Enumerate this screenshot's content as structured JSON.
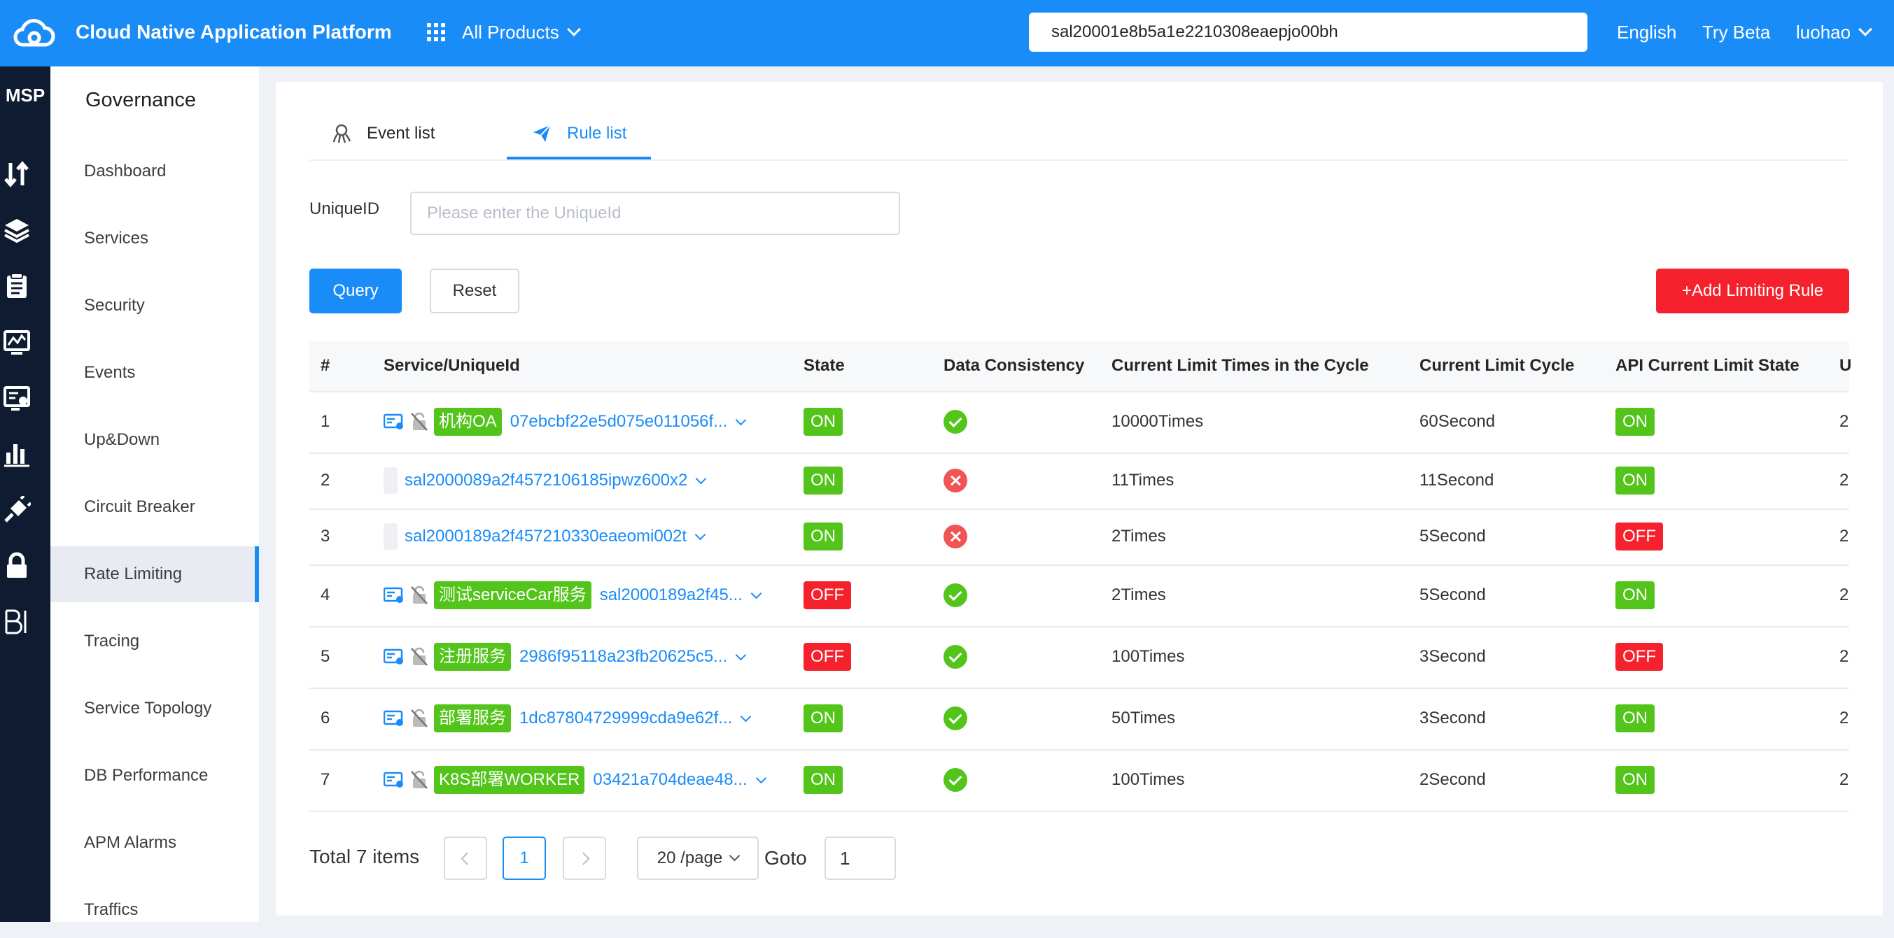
{
  "header": {
    "app_title": "Cloud Native Application Platform",
    "products_label": "All Products",
    "tenant_id": "sal20001e8b5a1e2210308eaepjo00bh",
    "language": "English",
    "try_beta": "Try Beta",
    "username": "luohao",
    "brand_color": "#1a8cf8"
  },
  "rail": {
    "label": "MSP",
    "icons": [
      "up-down-icon",
      "layers-icon",
      "clipboard-icon",
      "monitor-chart-icon",
      "monitor-user-icon",
      "bar-chart-icon",
      "plug-icon",
      "lock-icon",
      "bi-icon"
    ]
  },
  "menu": {
    "title": "Governance",
    "items": [
      "Dashboard",
      "Services",
      "Security",
      "Events",
      "Up&Down",
      "Circuit Breaker",
      "Rate Limiting",
      "Tracing",
      "Service Topology",
      "DB Performance",
      "APM Alarms",
      "Traffics"
    ],
    "active": "Rate Limiting"
  },
  "tabs": [
    {
      "label": "Event list",
      "icon": "octopus-icon",
      "active": false
    },
    {
      "label": "Rule list",
      "icon": "paper-plane-icon",
      "active": true
    }
  ],
  "filter": {
    "label": "UniqueID",
    "placeholder": "Please enter the UniqueId"
  },
  "buttons": {
    "query": "Query",
    "reset": "Reset",
    "add": "+Add Limiting Rule"
  },
  "table": {
    "columns": [
      "#",
      "Service/UniqueId",
      "State",
      "Data Consistency",
      "Current Limit Times in the Cycle",
      "Current Limit Cycle",
      "API Current Limit State",
      "U"
    ],
    "rows": [
      {
        "index": "1",
        "icons": true,
        "tag": "机构OA",
        "uid": "07ebcbf22e5d075e011056f...",
        "state": "ON",
        "consistent": true,
        "times": "10000Times",
        "cycle": "60Second",
        "api_state": "ON",
        "extra": "2"
      },
      {
        "index": "2",
        "icons": false,
        "tag": "",
        "uid": "sal2000089a2f4572106185ipwz600x2",
        "state": "ON",
        "consistent": false,
        "times": "11Times",
        "cycle": "11Second",
        "api_state": "ON",
        "extra": "2"
      },
      {
        "index": "3",
        "icons": false,
        "tag": "",
        "uid": "sal2000189a2f457210330eaeomi002t",
        "state": "ON",
        "consistent": false,
        "times": "2Times",
        "cycle": "5Second",
        "api_state": "OFF",
        "extra": "2"
      },
      {
        "index": "4",
        "icons": true,
        "tag": "测试serviceCar服务",
        "uid": "sal2000189a2f45...",
        "state": "OFF",
        "consistent": true,
        "times": "2Times",
        "cycle": "5Second",
        "api_state": "ON",
        "extra": "2"
      },
      {
        "index": "5",
        "icons": true,
        "tag": "注册服务",
        "uid": "2986f95118a23fb20625c5...",
        "state": "OFF",
        "consistent": true,
        "times": "100Times",
        "cycle": "3Second",
        "api_state": "OFF",
        "extra": "2"
      },
      {
        "index": "6",
        "icons": true,
        "tag": "部署服务",
        "uid": "1dc87804729999cda9e62f...",
        "state": "ON",
        "consistent": true,
        "times": "50Times",
        "cycle": "3Second",
        "api_state": "ON",
        "extra": "2"
      },
      {
        "index": "7",
        "icons": true,
        "tag": "K8S部署WORKER",
        "uid": "03421a704deae48...",
        "state": "ON",
        "consistent": true,
        "times": "100Times",
        "cycle": "2Second",
        "api_state": "ON",
        "extra": "2"
      }
    ]
  },
  "pagination": {
    "total_text": "Total 7 items",
    "current_page": "1",
    "page_size": "20 /page",
    "goto_label": "Goto",
    "goto_value": "1"
  },
  "colors": {
    "on": "#52c41a",
    "off": "#f5222d",
    "error": "#f05454",
    "rail_bg": "#0f1b31"
  }
}
